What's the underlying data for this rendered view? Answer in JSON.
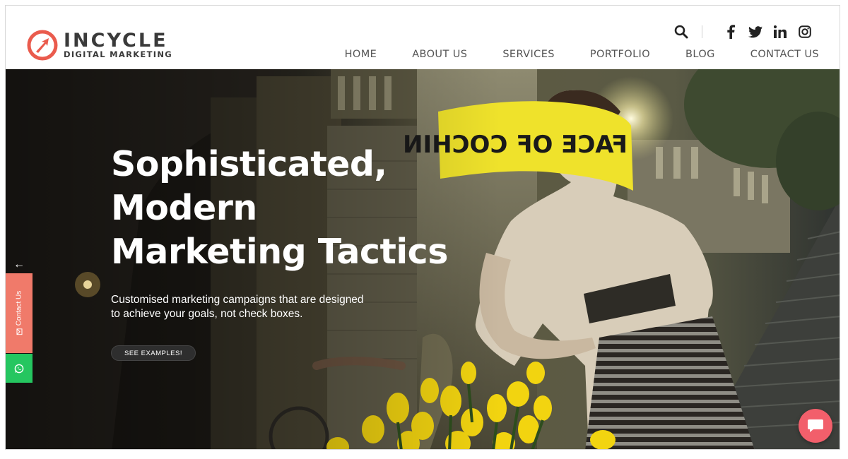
{
  "brand": {
    "name": "INCYCLE",
    "tagline": "DIGITAL MARKETING",
    "accent": "#ea5b4d"
  },
  "header_icons": {
    "search": "search-icon",
    "social": [
      "facebook-icon",
      "twitter-icon",
      "linkedin-icon",
      "instagram-icon"
    ]
  },
  "nav": {
    "items": [
      {
        "label": "HOME"
      },
      {
        "label": "ABOUT US"
      },
      {
        "label": "SERVICES"
      },
      {
        "label": "PORTFOLIO"
      },
      {
        "label": "BLOG"
      },
      {
        "label": "CONTACT US"
      }
    ]
  },
  "hero": {
    "title_lines": [
      "Sophisticated,",
      "Modern",
      "Marketing Tactics"
    ],
    "subtitle_lines": [
      "Customised marketing campaigns that are designed",
      "to achieve your goals, not check boxes."
    ],
    "cta_label": "SEE EXAMPLES!",
    "banner_text": "FACE OF COCHIN"
  },
  "side_tab": {
    "arrow": "←",
    "contact_label": "Contact Us",
    "contact_color": "#f07a6a",
    "whatsapp_color": "#25c660"
  },
  "chat_widget": {
    "icon": "chat-bubble-icon",
    "color": "#f25f6b"
  }
}
